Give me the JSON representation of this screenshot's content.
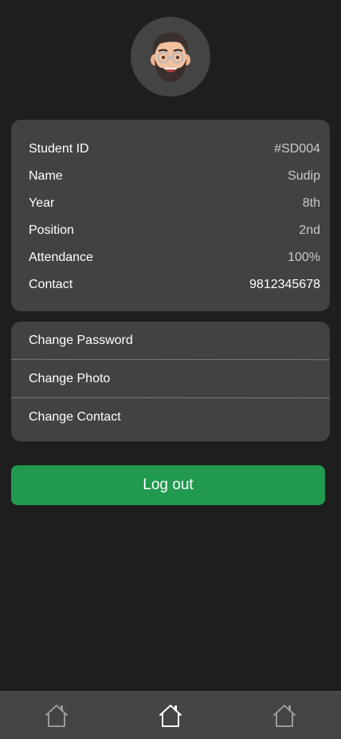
{
  "profile": {
    "avatar_icon": "memoji-avatar-icon"
  },
  "student_info": [
    {
      "label": "Student ID",
      "value": "#SD004"
    },
    {
      "label": "Name",
      "value": "Sudip"
    },
    {
      "label": "Year",
      "value": "8th"
    },
    {
      "label": "Position",
      "value": "2nd"
    },
    {
      "label": "Attendance",
      "value": "100%"
    },
    {
      "label": "Contact",
      "value": "9812345678"
    }
  ],
  "settings": [
    {
      "label": "Change Password"
    },
    {
      "label": "Change Photo"
    },
    {
      "label": "Change Contact"
    }
  ],
  "logout": {
    "label": "Log out"
  },
  "bottom_nav": [
    {
      "icon": "home-icon",
      "active": false
    },
    {
      "icon": "home-icon",
      "active": true
    },
    {
      "icon": "home-icon",
      "active": false
    }
  ],
  "colors": {
    "background": "#1e1e1e",
    "card": "#424242",
    "accent_green": "#21994f",
    "nav_bar": "#444444",
    "muted_text": "#c9c9c9"
  }
}
